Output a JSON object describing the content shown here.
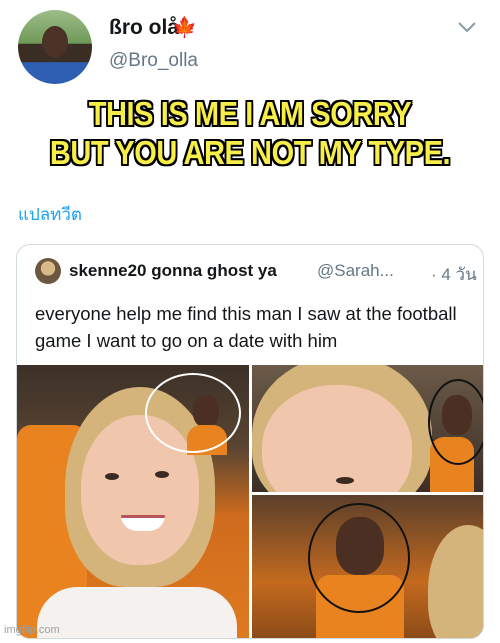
{
  "tweet": {
    "display_name": "ßro olå",
    "handle": "@Bro_olla",
    "caption_line1": "THIS IS ME I AM SORRY",
    "caption_line2": "BUT YOU ARE NOT MY TYPE.",
    "translate_label": "แปลทวีต"
  },
  "quoted_tweet": {
    "author_name": "skenne20 gonna ghost ya",
    "author_handle": "@Sarah...",
    "timestamp": "· 4 วัน",
    "text": "everyone help me find this man I saw at the football game I want to go on a date with him"
  },
  "icons": {
    "leaf": "maple-leaf-icon",
    "chevron": "chevron-down-icon"
  },
  "watermark": "imgflip.com",
  "colors": {
    "caption_fill": "#f7ee4a",
    "link": "#1da1f2",
    "muted": "#657786"
  }
}
